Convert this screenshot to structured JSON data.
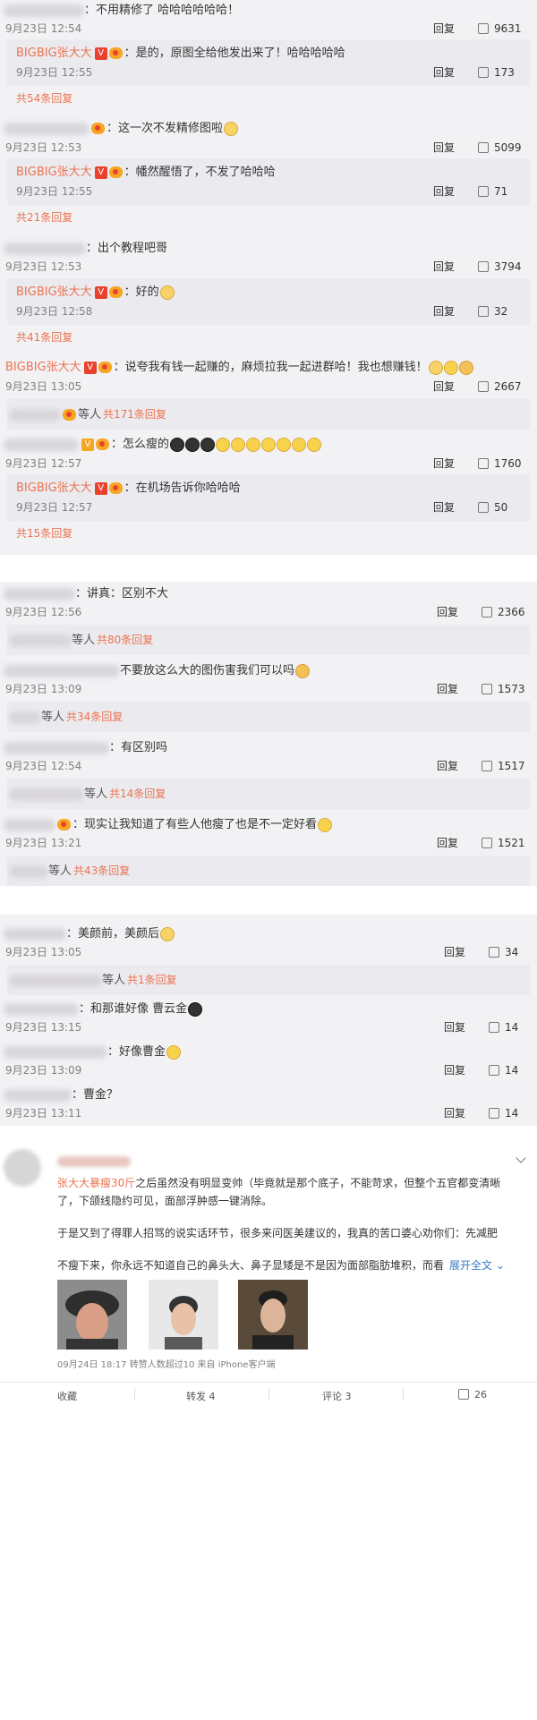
{
  "c1": {
    "text": "：不用精修了 哈哈哈哈哈哈！",
    "time": "9月23日 12:54",
    "reply": "回复",
    "likes": "9631",
    "sub": {
      "name": "BIGBIG张大大",
      "text": "：是的，原图全给他发出来了！哈哈哈哈哈",
      "time": "9月23日 12:55",
      "reply": "回复",
      "likes": "173"
    },
    "more": "共54条回复"
  },
  "c2": {
    "text": "：这一次不发精修图啦",
    "time": "9月23日 12:53",
    "reply": "回复",
    "likes": "5099",
    "sub": {
      "name": "BIGBIG张大大",
      "text": "：幡然醒悟了，不发了哈哈哈",
      "time": "9月23日 12:55",
      "reply": "回复",
      "likes": "71"
    },
    "more": "共21条回复"
  },
  "c3": {
    "text": "：出个教程吧哥",
    "time": "9月23日 12:53",
    "reply": "回复",
    "likes": "3794",
    "sub": {
      "name": "BIGBIG张大大",
      "text": "：好的",
      "time": "9月23日 12:58",
      "reply": "回复",
      "likes": "32"
    },
    "more": "共41条回复"
  },
  "c4": {
    "name": "BIGBIG张大大",
    "text": "：说夸我有钱一起赚的，麻烦拉我一起进群哈！我也想赚钱！",
    "time": "9月23日 13:05",
    "reply": "回复",
    "likes": "2667",
    "deng": "等人",
    "more": "共171条回复"
  },
  "c5": {
    "text": "：怎么瘦的",
    "time": "9月23日 12:57",
    "reply": "回复",
    "likes": "1760",
    "sub": {
      "name": "BIGBIG张大大",
      "text": "：在机场告诉你哈哈哈",
      "time": "9月23日 12:57",
      "reply": "回复",
      "likes": "50"
    },
    "more": "共15条回复"
  },
  "c6": {
    "text": "：讲真：区别不大",
    "time": "9月23日 12:56",
    "reply": "回复",
    "likes": "2366",
    "deng": "等人",
    "more": "共80条回复"
  },
  "c7": {
    "text": "不要放这么大的图伤害我们可以吗",
    "time": "9月23日 13:09",
    "reply": "回复",
    "likes": "1573",
    "deng": "等人",
    "more": "共34条回复"
  },
  "c8": {
    "text": "：有区别吗",
    "time": "9月23日 12:54",
    "reply": "回复",
    "likes": "1517",
    "deng": "等人",
    "more": "共14条回复"
  },
  "c9": {
    "text": "：现实让我知道了有些人他瘦了也是不一定好看",
    "time": "9月23日 13:21",
    "reply": "回复",
    "likes": "1521",
    "deng": "等人",
    "more": "共43条回复"
  },
  "c10": {
    "text": "：美颜前，美颜后",
    "time": "9月23日 13:05",
    "reply": "回复",
    "likes": "34",
    "deng": "等人",
    "more": "共1条回复"
  },
  "c11": {
    "text": "：和那谁好像 曹云金",
    "time": "9月23日 13:15",
    "reply": "回复",
    "likes": "14"
  },
  "c12": {
    "text": "：好像曹金",
    "time": "9月23日 13:09",
    "reply": "回复",
    "likes": "14"
  },
  "c13": {
    "text": "：曹金？",
    "time": "9月23日 13:11",
    "reply": "回复",
    "likes": "14"
  },
  "post": {
    "line1a": "张大大暴瘦30斤",
    "line1b": "之后虽然没有明显变帅（毕竟就是那个底子，不能苛求，但整个五官都变清晰",
    "line2": "了，下颌线隐约可见，面部浮肿感一键消除。",
    "line3": "于是又到了得罪人招骂的说实话环节，很多来问医美建议的，我真的苦口婆心劝你们：先减肥",
    "line4a": "不瘦下来，你永远不知道自己的鼻头大、鼻子显矮是不是因为面部脂肪堆积，而看",
    "expand": "展开全文",
    "meta": "09月24日 18:17 转赞人数超过10  来自 iPhone客户端",
    "footer": {
      "collect": "收藏",
      "forward": "转发 4",
      "comment": "评论 3",
      "like": "26"
    }
  },
  "colors": {
    "accent": "#eb7350",
    "panel": "#f2f2f5",
    "subpanel": "#ebebef"
  },
  "icons": {
    "like": "thumb-up-icon",
    "verified": "v-badge-icon",
    "vip": "vip-badge-icon",
    "chevron": "chevron-down-icon"
  }
}
